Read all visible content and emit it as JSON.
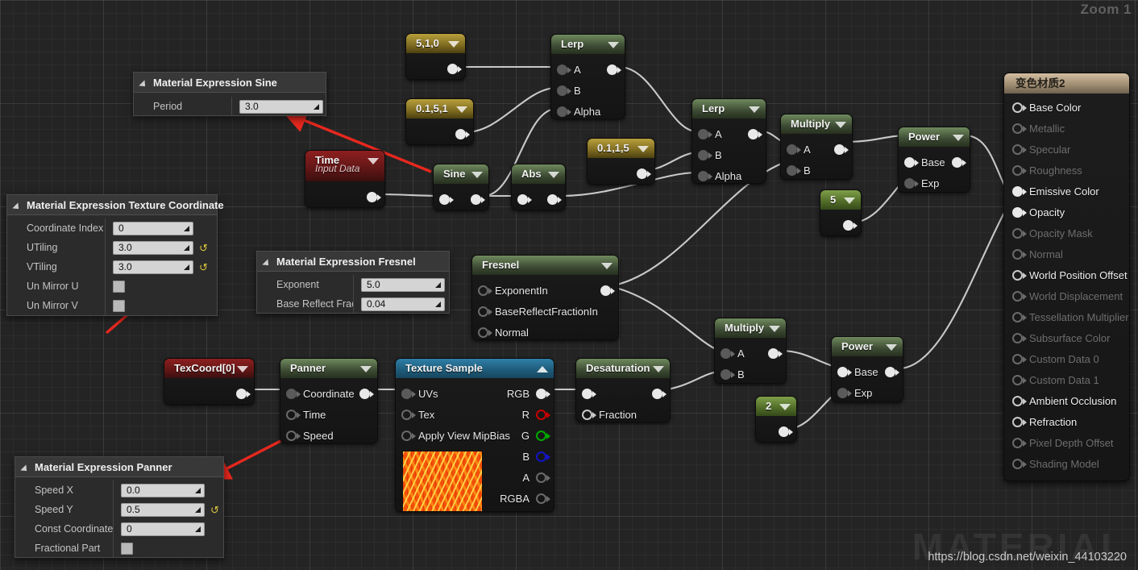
{
  "overlay": {
    "zoom_label": "Zoom 1",
    "watermark_big": "MATERIAL",
    "watermark_url": "https://blog.csdn.net/weixin_44103220"
  },
  "panels": {
    "sine": {
      "title": "Material Expression Sine",
      "rows": [
        {
          "name": "Period",
          "value": "3.0",
          "type": "field",
          "revert": false
        }
      ]
    },
    "texcoord": {
      "title": "Material Expression Texture Coordinate",
      "rows": [
        {
          "name": "Coordinate Index",
          "value": "0",
          "type": "field",
          "revert": false
        },
        {
          "name": "UTiling",
          "value": "3.0",
          "type": "field",
          "revert": true
        },
        {
          "name": "VTiling",
          "value": "3.0",
          "type": "field",
          "revert": true
        },
        {
          "name": "Un Mirror U",
          "value": "",
          "type": "checkbox",
          "revert": false
        },
        {
          "name": "Un Mirror V",
          "value": "",
          "type": "checkbox",
          "revert": false
        }
      ]
    },
    "fresnel": {
      "title": "Material Expression Fresnel",
      "rows": [
        {
          "name": "Exponent",
          "value": "5.0",
          "type": "field",
          "revert": false
        },
        {
          "name": "Base Reflect Fractio",
          "value": "0.04",
          "type": "field",
          "revert": false
        }
      ]
    },
    "panner": {
      "title": "Material Expression Panner",
      "rows": [
        {
          "name": "Speed X",
          "value": "0.0",
          "type": "field",
          "revert": false
        },
        {
          "name": "Speed Y",
          "value": "0.5",
          "type": "field",
          "revert": true
        },
        {
          "name": "Const Coordinate",
          "value": "0",
          "type": "field",
          "revert": false
        },
        {
          "name": "Fractional Part",
          "value": "",
          "type": "checkbox",
          "revert": false
        }
      ]
    }
  },
  "nodes": {
    "const_510": {
      "title": "5,1,0",
      "color": "gold"
    },
    "const_0151": {
      "title": "0.1,5,1",
      "color": "gold"
    },
    "const_0115": {
      "title": "0.1,1,5",
      "color": "gold"
    },
    "const_5": {
      "title": "5",
      "color": "olive"
    },
    "const_2": {
      "title": "2",
      "color": "olive"
    },
    "lerp_top": {
      "title": "Lerp",
      "inputs": [
        "A",
        "B",
        "Alpha"
      ]
    },
    "lerp_mid": {
      "title": "Lerp",
      "inputs": [
        "A",
        "B",
        "Alpha"
      ]
    },
    "time": {
      "title": "Time",
      "subtitle": "Input Data"
    },
    "sine": {
      "title": "Sine"
    },
    "abs": {
      "title": "Abs"
    },
    "multiply_top": {
      "title": "Multiply",
      "inputs": [
        "A",
        "B"
      ]
    },
    "multiply_bottom": {
      "title": "Multiply",
      "inputs": [
        "A",
        "B"
      ]
    },
    "power_top": {
      "title": "Power",
      "inputs": [
        "Base",
        "Exp"
      ]
    },
    "power_bottom": {
      "title": "Power",
      "inputs": [
        "Base",
        "Exp"
      ]
    },
    "fresnel": {
      "title": "Fresnel",
      "inputs": [
        "ExponentIn",
        "BaseReflectFractionIn",
        "Normal"
      ]
    },
    "texcoord": {
      "title": "TexCoord[0]"
    },
    "panner": {
      "title": "Panner",
      "inputs": [
        "Coordinate",
        "Time",
        "Speed"
      ]
    },
    "texture_sample": {
      "title": "Texture Sample",
      "inputs": [
        "UVs",
        "Tex",
        "Apply View MipBias"
      ],
      "outputs": [
        "RGB",
        "R",
        "G",
        "B",
        "A",
        "RGBA"
      ]
    },
    "desaturation": {
      "title": "Desaturation",
      "inputs": [
        "Fraction"
      ]
    }
  },
  "material_output": {
    "title": "变色材质2",
    "pins": [
      {
        "label": "Base Color",
        "enabled": true,
        "connected": false
      },
      {
        "label": "Metallic",
        "enabled": false,
        "connected": false
      },
      {
        "label": "Specular",
        "enabled": false,
        "connected": false
      },
      {
        "label": "Roughness",
        "enabled": false,
        "connected": false
      },
      {
        "label": "Emissive Color",
        "enabled": true,
        "connected": true
      },
      {
        "label": "Opacity",
        "enabled": true,
        "connected": true
      },
      {
        "label": "Opacity Mask",
        "enabled": false,
        "connected": false
      },
      {
        "label": "Normal",
        "enabled": false,
        "connected": false
      },
      {
        "label": "World Position Offset",
        "enabled": true,
        "connected": false
      },
      {
        "label": "World Displacement",
        "enabled": false,
        "connected": false
      },
      {
        "label": "Tessellation Multiplier",
        "enabled": false,
        "connected": false
      },
      {
        "label": "Subsurface Color",
        "enabled": false,
        "connected": false
      },
      {
        "label": "Custom Data 0",
        "enabled": false,
        "connected": false
      },
      {
        "label": "Custom Data 1",
        "enabled": false,
        "connected": false
      },
      {
        "label": "Ambient Occlusion",
        "enabled": true,
        "connected": false
      },
      {
        "label": "Refraction",
        "enabled": true,
        "connected": false
      },
      {
        "label": "Pixel Depth Offset",
        "enabled": false,
        "connected": false
      },
      {
        "label": "Shading Model",
        "enabled": false,
        "connected": false
      }
    ]
  },
  "colors": {
    "accent_red_arrow": "#e8281e",
    "wire": "#d7d7d7",
    "canvas_bg": "#242424"
  }
}
